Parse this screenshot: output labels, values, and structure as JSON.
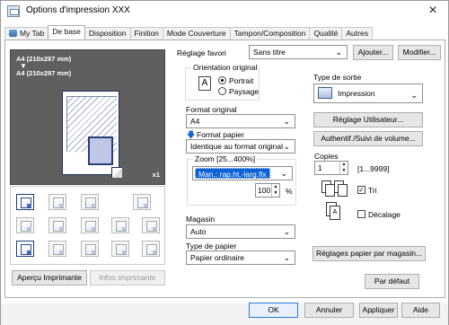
{
  "window": {
    "title": "Options d'impression XXX"
  },
  "tabs": [
    {
      "label": "My Tab"
    },
    {
      "label": "De base"
    },
    {
      "label": "Disposition"
    },
    {
      "label": "Finition"
    },
    {
      "label": "Mode Couverture"
    },
    {
      "label": "Tampon/Composition"
    },
    {
      "label": "Qualité"
    },
    {
      "label": "Autres"
    }
  ],
  "preview": {
    "size_top": "A4 (210x297 mm)",
    "size_bottom": "A4 (210x297 mm)",
    "copies_badge": "x1"
  },
  "left_buttons": {
    "printer_preview": "Aperçu Imprimante",
    "printer_info": "Infos imprimante"
  },
  "favorites": {
    "label": "Réglage favori",
    "value": "Sans titre",
    "add_button": "Ajouter...",
    "modify_button": "Modifier..."
  },
  "orientation": {
    "group_title": "Orientation original",
    "portrait": "Portrait",
    "landscape": "Paysage",
    "selected": "Portrait"
  },
  "original_size": {
    "label": "Format original",
    "value": "A4"
  },
  "paper_size": {
    "label": "Format papier",
    "value": "Identique au format original"
  },
  "zoom": {
    "group_title": "Zoom [25...400%]",
    "mode": "Man.: rap.ht.-larg.fix",
    "value": "100",
    "unit": "%"
  },
  "paper_tray": {
    "label": "Magasin",
    "value": "Auto"
  },
  "paper_type": {
    "label": "Type de papier",
    "value": "Papier ordinaire"
  },
  "output_type": {
    "label": "Type de sortie",
    "value": "Impression"
  },
  "user_settings_button": "Réglage Utilisateur...",
  "auth_button": "Authentif./Suivi de volume...",
  "copies": {
    "label": "Copies",
    "value": "1",
    "range": "[1...9999]"
  },
  "collate": {
    "label": "Tri",
    "checked": true
  },
  "offset": {
    "label": "Décalage",
    "checked": false
  },
  "paper_settings_button": "Réglages papier par magasin...",
  "default_button": "Par défaut",
  "footer": {
    "ok": "OK",
    "cancel": "Annuler",
    "apply": "Appliquer",
    "help": "Aide"
  }
}
